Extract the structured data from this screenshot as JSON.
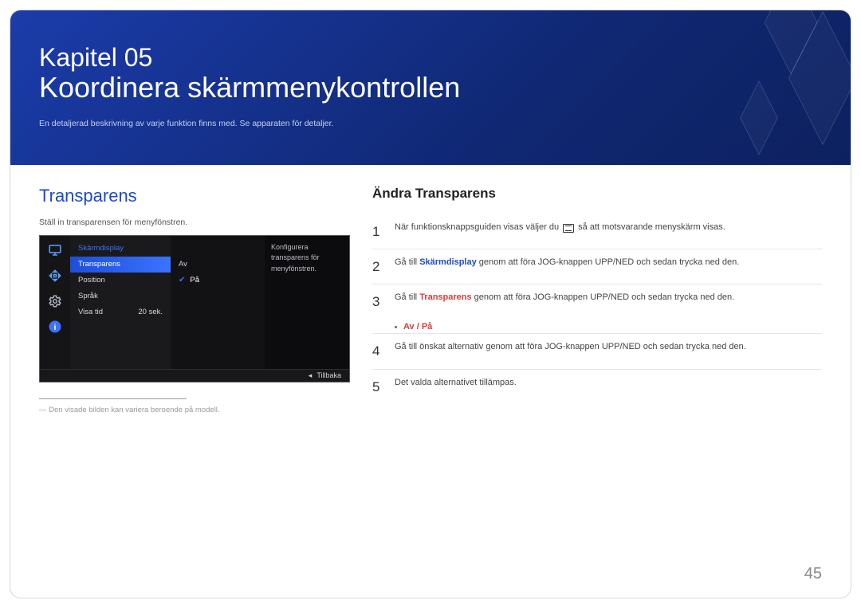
{
  "header": {
    "chapter": "Kapitel 05",
    "title": "Koordinera skärmmenykontrollen",
    "subtitle": "En detaljerad beskrivning av varje funktion finns med. Se apparaten för detaljer."
  },
  "left": {
    "section_title": "Transparens",
    "desc": "Ställ in transparensen för menyfönstren.",
    "footnote": "Den visade bilden kan variera beroende på modell."
  },
  "mock": {
    "menu_title": "Skärmdisplay",
    "items": [
      {
        "label": "Transparens",
        "value": ""
      },
      {
        "label": "Position",
        "value": ""
      },
      {
        "label": "Språk",
        "value": ""
      },
      {
        "label": "Visa tid",
        "value": "20 sek."
      }
    ],
    "options": {
      "off": "Av",
      "on": "På"
    },
    "help": "Konfigurera transparens för menyfönstren.",
    "back": "Tillbaka"
  },
  "right": {
    "heading": "Ändra Transparens",
    "steps": {
      "s1a": "När funktionsknappsguiden visas väljer du ",
      "s1b": " så att motsvarande menyskärm visas.",
      "s2a": "Gå till ",
      "s2_key": "Skärmdisplay",
      "s2b": " genom att föra JOG-knappen UPP/NED och sedan trycka ned den.",
      "s3a": "Gå till ",
      "s3_key": "Transparens",
      "s3b": " genom att föra JOG-knappen UPP/NED och sedan trycka ned den.",
      "bullet": "Av / På",
      "s4": "Gå till önskat alternativ genom att föra JOG-knappen UPP/NED och sedan trycka ned den.",
      "s5": "Det valda alternativet tillämpas."
    }
  },
  "page_number": "45"
}
